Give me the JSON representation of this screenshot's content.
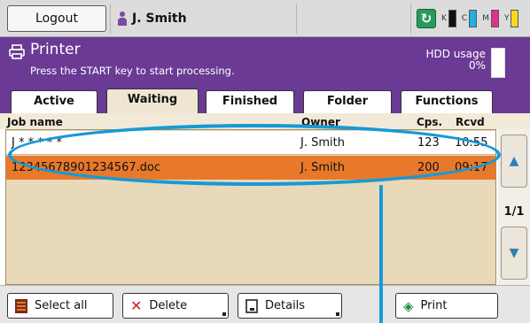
{
  "topbar": {
    "logout_label": "Logout",
    "user_name": "J. Smith",
    "inks": [
      {
        "label": "K",
        "color": "#111111"
      },
      {
        "label": "C",
        "color": "#22aee6"
      },
      {
        "label": "M",
        "color": "#e0328c"
      },
      {
        "label": "Y",
        "color": "#f2dc1e"
      }
    ]
  },
  "header": {
    "title": "Printer",
    "message": "Press the START key to start processing.",
    "hdd_label": "HDD usage",
    "hdd_value": "0%"
  },
  "tabs": [
    {
      "label": "Active"
    },
    {
      "label": "Waiting"
    },
    {
      "label": "Finished"
    },
    {
      "label": "Folder"
    },
    {
      "label": "Functions"
    }
  ],
  "columns": {
    "job_name": "Job name",
    "owner": "Owner",
    "copies": "Cps.",
    "received": "Rcvd"
  },
  "jobs": [
    {
      "name": "J * * * * *",
      "owner": "J. Smith",
      "copies": "123",
      "received": "10:55"
    },
    {
      "name": "12345678901234567.doc",
      "owner": "J. Smith",
      "copies": "200",
      "received": "09:17"
    }
  ],
  "page_indicator": "1/1",
  "buttons": {
    "select_all": "Select all",
    "delete": "Delete",
    "details": "Details",
    "print": "Print"
  },
  "colors": {
    "accent": "#6a3a94",
    "selected_row": "#e8792a",
    "list_bg": "#e8d9b8",
    "callout": "#1799d8"
  }
}
